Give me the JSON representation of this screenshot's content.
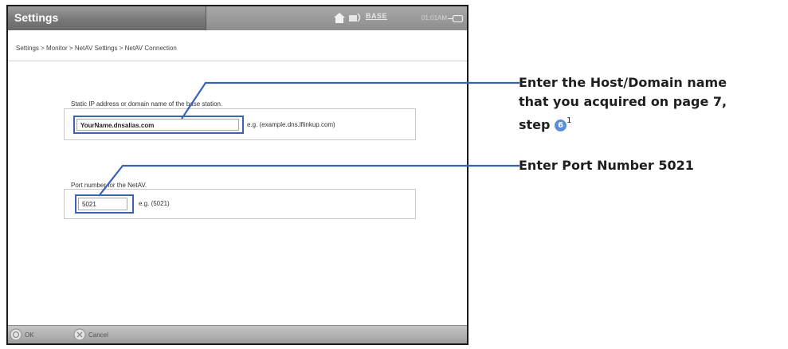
{
  "titlebar": {
    "title": "Settings",
    "logo": "BASE",
    "time": "01:01AM",
    "icons": [
      "home-icon",
      "signal-icon",
      "battery-icon"
    ]
  },
  "breadcrumb": "Settings > Monitor > NetAV Settings > NetAV Connection",
  "host_section": {
    "label": "Static IP address or domain name of the base station.",
    "value": "YourName.dnsalias.com",
    "example": "e.g. (example.dns.lflinkup.com)"
  },
  "port_section": {
    "label": "Port number for the NetAV.",
    "value": "5021",
    "example": "e.g.  (5021)"
  },
  "buttons": {
    "ok": "OK",
    "cancel": "Cancel"
  },
  "callouts": {
    "host": {
      "line1": "Enter the Host/Domain name",
      "line2": "that you acquired on page 7,",
      "line3": "step",
      "step_number": "6",
      "footnote": "1"
    },
    "port": "Enter Port Number 5021"
  },
  "colors": {
    "highlight": "#3b63b5",
    "titlebar": "#7a7a7a",
    "step_badge": "#5b8ed6"
  }
}
